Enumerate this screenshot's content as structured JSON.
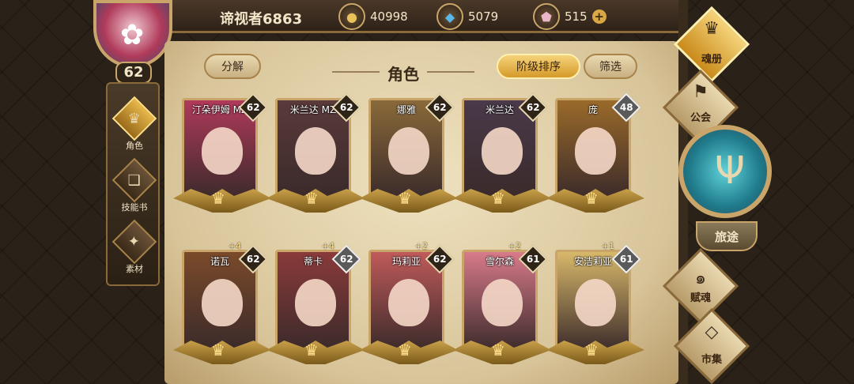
{
  "player": {
    "name": "谛视者6863",
    "level": "62"
  },
  "currencies": [
    {
      "icon": "gold-coin-icon",
      "symbol": "●",
      "value": "40998"
    },
    {
      "icon": "blue-crystal-icon",
      "symbol": "◆",
      "value": "5079"
    },
    {
      "icon": "pink-gem-icon",
      "symbol": "⬟",
      "value": "515"
    }
  ],
  "left_nav": [
    {
      "label": "角色",
      "icon": "character-icon",
      "glyph": "♛",
      "active": true
    },
    {
      "label": "技能书",
      "icon": "skill-book-icon",
      "glyph": "❑",
      "active": false
    },
    {
      "label": "素材",
      "icon": "material-icon",
      "glyph": "✦",
      "active": false
    }
  ],
  "toolbar": {
    "decompose": "分解",
    "title": "角色",
    "sort": "阶级排序",
    "filter": "筛选"
  },
  "cards": [
    {
      "name": "汀朵伊姆 MZ",
      "level": "62",
      "plus": "",
      "tone": "#b03a5a"
    },
    {
      "name": "米兰达 MZ",
      "level": "62",
      "plus": "",
      "tone": "#5a3a3a"
    },
    {
      "name": "娜雅",
      "level": "62",
      "plus": "",
      "tone": "#8a6a3a"
    },
    {
      "name": "米兰达",
      "level": "62",
      "plus": "",
      "tone": "#4a3a4a"
    },
    {
      "name": "庞",
      "level": "48",
      "plus": "",
      "tone": "#9a6a2a"
    },
    {
      "name": "诺瓦",
      "level": "62",
      "plus": "+4",
      "tone": "#7a4a2a"
    },
    {
      "name": "蒂卡",
      "level": "62",
      "plus": "+4",
      "tone": "#8a3a3a"
    },
    {
      "name": "玛莉亚",
      "level": "62",
      "plus": "+2",
      "tone": "#c05a5a"
    },
    {
      "name": "雪尔森",
      "level": "61",
      "plus": "+2",
      "tone": "#d87a8a"
    },
    {
      "name": "安洁莉亚",
      "level": "61",
      "plus": "+1",
      "tone": "#d8b86a"
    }
  ],
  "right_nav": {
    "soul_book": "魂册",
    "guild": "公会",
    "journey": "旅途",
    "soul_gift": "赋魂",
    "market": "市集"
  }
}
